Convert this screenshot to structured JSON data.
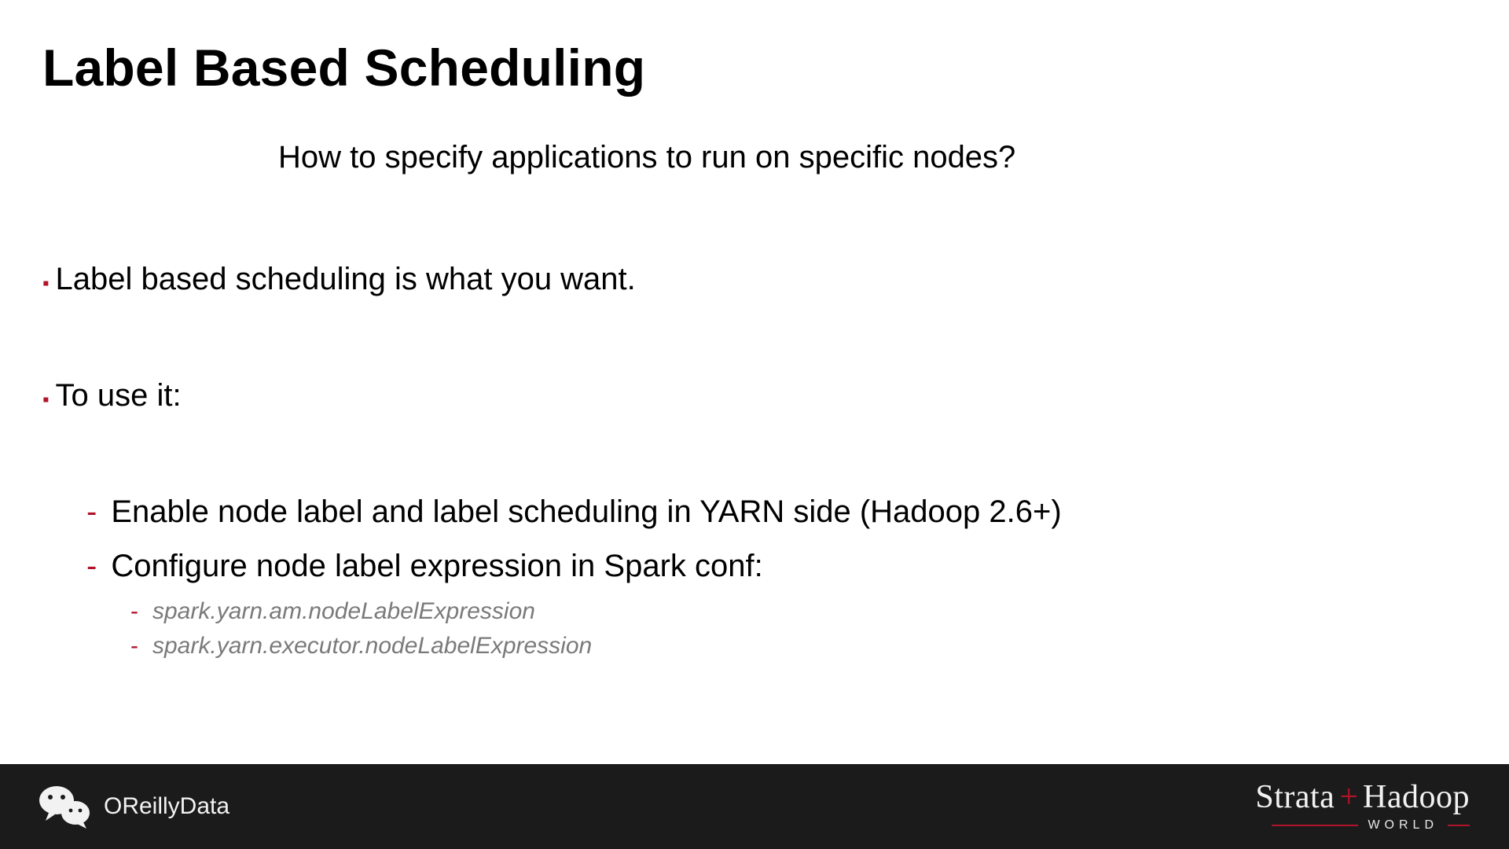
{
  "title": "Label Based Scheduling",
  "subtitle": "How to specify applications to run on specific nodes?",
  "bullets": {
    "b1": "Label based scheduling is what you want.",
    "b2": "To use it:",
    "sub1": "Enable node label and label scheduling in YARN side (Hadoop 2.6+)",
    "sub2": "Configure node label expression in Spark conf:",
    "subsub1": "spark.yarn.am.nodeLabelExpression",
    "subsub2": "spark.yarn.executor.nodeLabelExpression"
  },
  "footer": {
    "left_text": "OReillyData",
    "brand_strata": "Strata",
    "brand_plus": "+",
    "brand_hadoop": "Hadoop",
    "brand_world": "WORLD"
  }
}
